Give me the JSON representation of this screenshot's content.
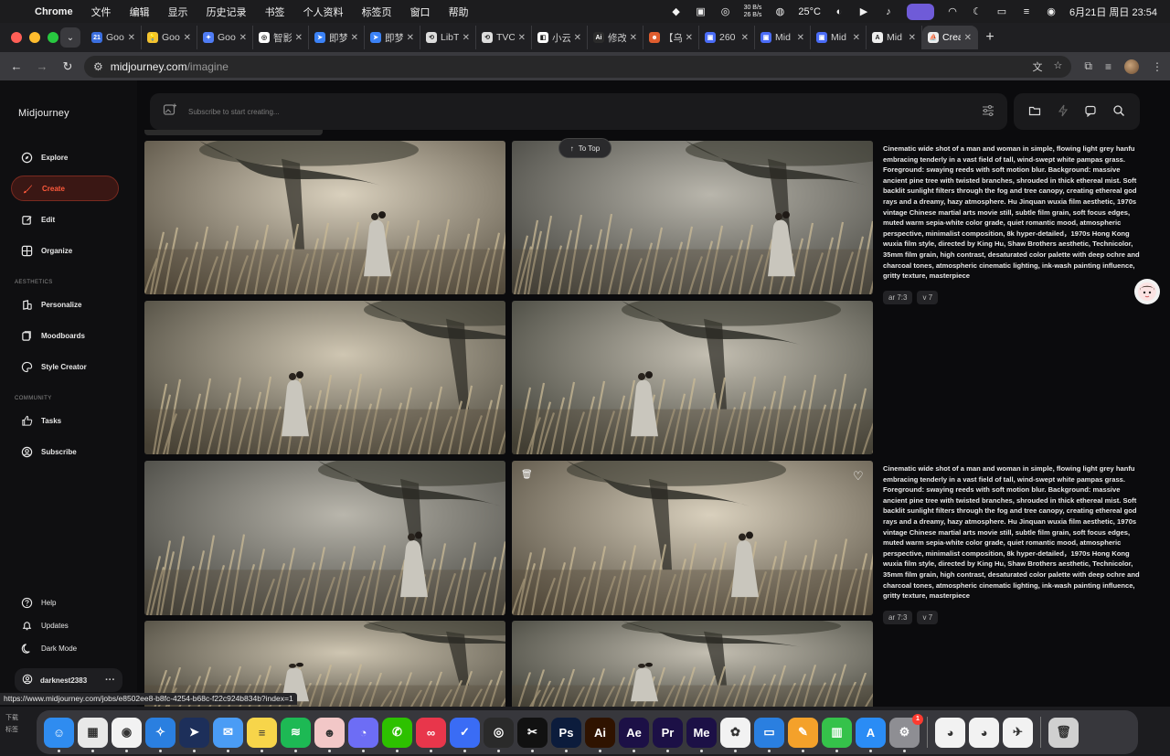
{
  "menubar": {
    "app": "Chrome",
    "items": [
      "文件",
      "编辑",
      "显示",
      "历史记录",
      "书签",
      "个人资料",
      "标签页",
      "窗口",
      "帮助"
    ],
    "net_up": "30 B/s",
    "net_down": "26 B/s",
    "temperature": "25°C",
    "clock": "6月21日 周日  23:54"
  },
  "tabs": [
    {
      "title": "Goo",
      "color": "#3b6fe0",
      "glyph": "21"
    },
    {
      "title": "Goo",
      "color": "#f4c430",
      "glyph": "💡"
    },
    {
      "title": "Goo",
      "color": "#4f7cf5",
      "glyph": "✦"
    },
    {
      "title": "智影",
      "color": "#ffffff",
      "glyph": "◎"
    },
    {
      "title": "即梦",
      "color": "#3b82f6",
      "glyph": "➤"
    },
    {
      "title": "即梦",
      "color": "#3b82f6",
      "glyph": "➤"
    },
    {
      "title": "LibT",
      "color": "#dddddd",
      "glyph": "⟲"
    },
    {
      "title": "TVC",
      "color": "#dddddd",
      "glyph": "⟲"
    },
    {
      "title": "小云",
      "color": "#ffffff",
      "glyph": "◧"
    },
    {
      "title": "修改",
      "color": "#2b2b2b",
      "glyph": "Ai"
    },
    {
      "title": "【乌",
      "color": "#e05d2e",
      "glyph": "☻"
    },
    {
      "title": "260",
      "color": "#4a6cf7",
      "glyph": "▣"
    },
    {
      "title": "Mid",
      "color": "#4a6cf7",
      "glyph": "▣"
    },
    {
      "title": "Mid",
      "color": "#4a6cf7",
      "glyph": "▣"
    },
    {
      "title": "Mid",
      "color": "#eeeeee",
      "glyph": "A"
    },
    {
      "title": "Crea",
      "color": "#eeeeee",
      "glyph": "⛵"
    }
  ],
  "address": {
    "host": "midjourney.com",
    "path": "/imagine"
  },
  "sidebar": {
    "brand": "Midjourney",
    "nav": [
      {
        "label": "Explore",
        "icon": "compass-icon"
      },
      {
        "label": "Create",
        "icon": "brush-icon"
      },
      {
        "label": "Edit",
        "icon": "edit-icon"
      },
      {
        "label": "Organize",
        "icon": "grid-icon"
      }
    ],
    "aesthetics_title": "AESTHETICS",
    "aesthetics": [
      {
        "label": "Personalize",
        "icon": "personalize-icon"
      },
      {
        "label": "Moodboards",
        "icon": "moodboard-icon"
      },
      {
        "label": "Style Creator",
        "icon": "palette-icon"
      }
    ],
    "community_title": "COMMUNITY",
    "community": [
      {
        "label": "Tasks",
        "icon": "thumbs-up-icon"
      },
      {
        "label": "Subscribe",
        "icon": "user-circle-icon"
      }
    ],
    "footer": [
      {
        "label": "Help",
        "icon": "help-icon"
      },
      {
        "label": "Updates",
        "icon": "bell-icon"
      },
      {
        "label": "Dark Mode",
        "icon": "moon-icon"
      }
    ],
    "username": "darknest2383"
  },
  "prompt_bar": {
    "placeholder": "Subscribe to start creating..."
  },
  "to_top": "To Top",
  "jobs": [
    {
      "prompt": "Cinematic wide shot of a man and woman in simple, flowing light grey hanfu embracing tenderly in a vast field of tall, wind-swept white pampas grass. Foreground: swaying reeds with soft motion blur. Background: massive ancient pine tree with twisted branches, shrouded in thick ethereal mist. Soft backlit sunlight filters through the fog and tree canopy, creating ethereal god rays and a dreamy, hazy atmosphere. Hu Jinquan wuxia film aesthetic, 1970s vintage Chinese martial arts movie still, subtle film grain, soft focus edges, muted warm sepia-white color grade, quiet romantic mood, atmospheric perspective, minimalist composition, 8k hyper-detailed，1970s Hong Kong wuxia film style, directed by King Hu, Shaw Brothers aesthetic, Technicolor, 35mm film grain, high contrast, desaturated color palette with deep ochre and charcoal tones, atmospheric cinematic lighting, ink-wash painting influence, gritty texture, masterpiece",
      "tags": [
        "ar 7:3",
        "v 7"
      ]
    },
    {
      "prompt": "Cinematic wide shot of a man and woman in simple, flowing light grey hanfu embracing tenderly in a vast field of tall, wind-swept white pampas grass. Foreground: swaying reeds with soft motion blur. Background: massive ancient pine tree with twisted branches, shrouded in thick ethereal mist. Soft backlit sunlight filters through the fog and tree canopy, creating ethereal god rays and a dreamy, hazy atmosphere. Hu Jinquan wuxia film aesthetic, 1970s vintage Chinese martial arts movie still, subtle film grain, soft focus edges, muted warm sepia-white color grade, quiet romantic mood, atmospheric perspective, minimalist composition, 8k hyper-detailed，1970s Hong Kong wuxia film style, directed by King Hu, Shaw Brothers aesthetic, Technicolor, 35mm film grain, high contrast, desaturated color palette with deep ochre and charcoal tones, atmospheric cinematic lighting, ink-wash painting influence, gritty texture, masterpiece",
      "tags": [
        "ar 7:3",
        "v 7"
      ]
    }
  ],
  "status_url": "https://www.midjourney.com/jobs/e8502ee8-b8fc-4254-b68c-f22c924b834b?index=1",
  "bottom_left": {
    "downloads": "下载",
    "bookmarks": "标签"
  },
  "dock": {
    "apps": [
      {
        "name": "finder-icon",
        "bg": "#2f8cf0",
        "glyph": "☺"
      },
      {
        "name": "launchpad-icon",
        "bg": "#e8e8e8",
        "glyph": "▦"
      },
      {
        "name": "chrome-icon",
        "bg": "#f2f2f2",
        "glyph": "◉"
      },
      {
        "name": "safari-icon",
        "bg": "#2a7fe0",
        "glyph": "✧"
      },
      {
        "name": "feishu-send-icon",
        "bg": "#1d2f5a",
        "glyph": "➤"
      },
      {
        "name": "mail-icon",
        "bg": "#4a9cf5",
        "glyph": "✉"
      },
      {
        "name": "notes-icon",
        "bg": "#f7d54a",
        "glyph": "≡"
      },
      {
        "name": "spotify-icon",
        "bg": "#1db954",
        "glyph": "≋"
      },
      {
        "name": "avatar-app-icon",
        "bg": "#f2c7c7",
        "glyph": "☻"
      },
      {
        "name": "chat-app-icon",
        "bg": "#6d6df5",
        "glyph": "◔"
      },
      {
        "name": "wechat-icon",
        "bg": "#2dc100",
        "glyph": "✆"
      },
      {
        "name": "creative-cloud-icon",
        "bg": "#e8364b",
        "glyph": "∞"
      },
      {
        "name": "mail-check-icon",
        "bg": "#3a6cf5",
        "glyph": "✓"
      },
      {
        "name": "ai-app-icon",
        "bg": "#2a2a2a",
        "glyph": "◎"
      },
      {
        "name": "capcut-icon",
        "bg": "#111111",
        "glyph": "✂"
      },
      {
        "name": "photoshop-icon",
        "bg": "#0c1c3c",
        "glyph": "Ps"
      },
      {
        "name": "illustrator-icon",
        "bg": "#2f1300",
        "glyph": "Ai"
      },
      {
        "name": "after-effects-icon",
        "bg": "#1c1046",
        "glyph": "Ae"
      },
      {
        "name": "premiere-icon",
        "bg": "#1c1046",
        "glyph": "Pr"
      },
      {
        "name": "media-encoder-icon",
        "bg": "#1c1046",
        "glyph": "Me"
      },
      {
        "name": "baidu-netdisk-icon",
        "bg": "#f2f2f2",
        "glyph": "✿"
      },
      {
        "name": "keynote-icon",
        "bg": "#2a7fe0",
        "glyph": "▭"
      },
      {
        "name": "pages-icon",
        "bg": "#f4a12a",
        "glyph": "✎"
      },
      {
        "name": "numbers-icon",
        "bg": "#35c24a",
        "glyph": "▥"
      },
      {
        "name": "app-store-icon",
        "bg": "#2a8cf5",
        "glyph": "A"
      },
      {
        "name": "system-settings-icon",
        "bg": "#8e8e93",
        "glyph": "⚙",
        "badge": "1"
      },
      {
        "name": "qq-icon",
        "bg": "#f2f2f2",
        "glyph": "◕"
      },
      {
        "name": "qq-2-icon",
        "bg": "#f2f2f2",
        "glyph": "◕"
      },
      {
        "name": "feishu-icon",
        "bg": "#f2f2f2",
        "glyph": "✈"
      },
      {
        "name": "trash-icon",
        "bg": "#d0d0d0",
        "glyph": "🗑"
      }
    ]
  }
}
